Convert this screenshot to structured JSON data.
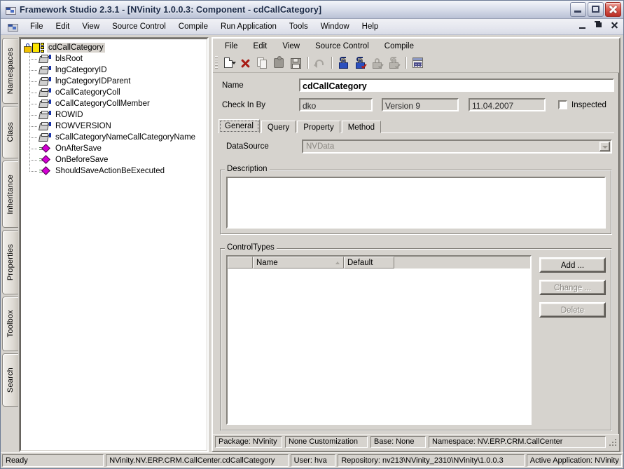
{
  "window": {
    "title": "Framework Studio 2.3.1 - [NVinity 1.0.0.3: Component - cdCallCategory]",
    "icon": "application-icon",
    "minimize": "minimize-icon",
    "maximize": "maximize-icon",
    "close": "close-icon"
  },
  "menubar": {
    "icon": "mdi-document-icon",
    "items": [
      {
        "label": "File"
      },
      {
        "label": "Edit"
      },
      {
        "label": "View"
      },
      {
        "label": "Source Control"
      },
      {
        "label": "Compile"
      },
      {
        "label": "Run Application"
      },
      {
        "label": "Tools"
      },
      {
        "label": "Window"
      },
      {
        "label": "Help"
      }
    ]
  },
  "vertical_tabs": [
    {
      "label": "Namespaces"
    },
    {
      "label": "Class"
    },
    {
      "label": "Inheritance"
    },
    {
      "label": "Properties"
    },
    {
      "label": "Toolbox"
    },
    {
      "label": "Search"
    }
  ],
  "tree": {
    "root": {
      "label": "cdCallCategory",
      "icon": "locked-class-icon"
    },
    "children": [
      {
        "label": "blsRoot",
        "icon": "property-icon"
      },
      {
        "label": "lngCategoryID",
        "icon": "property-icon"
      },
      {
        "label": "lngCategoryIDParent",
        "icon": "property-icon"
      },
      {
        "label": "oCallCategoryColl",
        "icon": "property-icon"
      },
      {
        "label": "oCallCategoryCollMember",
        "icon": "property-icon"
      },
      {
        "label": "ROWID",
        "icon": "property-icon"
      },
      {
        "label": "ROWVERSION",
        "icon": "property-icon"
      },
      {
        "label": "sCallCategoryNameCallCategoryName",
        "icon": "property-icon"
      },
      {
        "label": "OnAfterSave",
        "icon": "method-icon"
      },
      {
        "label": "OnBeforeSave",
        "icon": "method-icon"
      },
      {
        "label": "ShouldSaveActionBeExecuted",
        "icon": "method-icon"
      }
    ]
  },
  "mdi": {
    "menu": [
      {
        "label": "File"
      },
      {
        "label": "Edit"
      },
      {
        "label": "View"
      },
      {
        "label": "Source Control"
      },
      {
        "label": "Compile"
      }
    ],
    "toolbar": [
      {
        "icon": "new-document-icon",
        "name": "new"
      },
      {
        "icon": "delete-icon",
        "name": "delete"
      },
      {
        "icon": "copy-icon",
        "name": "copy"
      },
      {
        "icon": "puzzle-piece-icon",
        "name": "component"
      },
      {
        "icon": "save-icon",
        "name": "save"
      },
      {
        "icon": "undo-icon",
        "name": "undo"
      },
      {
        "icon": "check-out-icon",
        "name": "check-out"
      },
      {
        "icon": "check-in-icon",
        "name": "check-in"
      },
      {
        "icon": "undo-check-out-icon",
        "name": "undo-check-out"
      },
      {
        "icon": "get-latest-icon",
        "name": "get-latest"
      },
      {
        "icon": "history-icon",
        "name": "history"
      }
    ],
    "form": {
      "name_label": "Name",
      "name_value": "cdCallCategory",
      "checkin_label": "Check In By",
      "checkin_user": "dko",
      "version": "Version 9",
      "date": "11.04.2007",
      "inspected_label": "Inspected",
      "inspected_checked": false
    },
    "tabs": [
      {
        "label": "General",
        "active": true
      },
      {
        "label": "Query",
        "active": false
      },
      {
        "label": "Property",
        "active": false
      },
      {
        "label": "Method",
        "active": false
      }
    ],
    "general": {
      "datasource_label": "DataSource",
      "datasource_value": "NVData",
      "description_title": "Description",
      "description_value": ""
    },
    "controltypes": {
      "title": "ControlTypes",
      "columns": [
        "",
        "Name",
        "Default"
      ],
      "sort_column": "Name",
      "sort_direction": "asc",
      "rows": [],
      "buttons": [
        {
          "label": "Add ...",
          "enabled": true
        },
        {
          "label": "Change ...",
          "enabled": false
        },
        {
          "label": "Delete",
          "enabled": false
        }
      ]
    },
    "status": [
      {
        "text": "Package: NVinity"
      },
      {
        "text": "None Customization"
      },
      {
        "text": "Base: None"
      },
      {
        "text": "Namespace: NV.ERP.CRM.CallCenter"
      }
    ]
  },
  "appstatus": [
    {
      "text": "Ready"
    },
    {
      "text": "NVinity.NV.ERP.CRM.CallCenter.cdCallCategory"
    },
    {
      "text": "User: hva"
    },
    {
      "text": "Repository: nv213\\NVinity_2310\\NVinity\\1.0.0.3"
    },
    {
      "text": "Active Application: NVinity"
    }
  ],
  "colors": {
    "face": "#d6d3ce",
    "titlebar_text": "#1b2a47",
    "accent_close": "#b92e25",
    "selection": "#d7d3cd"
  }
}
